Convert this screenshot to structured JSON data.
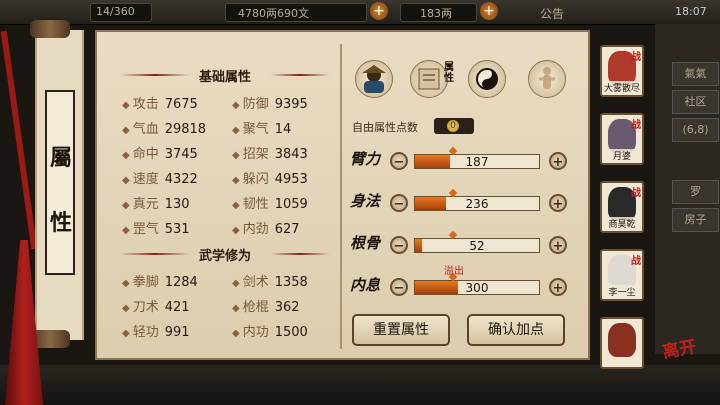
{
  "topbar": {
    "bag_text": "14/360",
    "money_text": "4780两690文",
    "silver_text": "183两",
    "notice_label": "公告",
    "clock": "18:07"
  },
  "side_tabs": [
    "氣氣",
    "社区",
    "(6,8)",
    "罗",
    "房子"
  ],
  "scroll": {
    "char1": "屬",
    "char2": "性"
  },
  "basic": {
    "title": "基础属性",
    "stats": [
      {
        "label": "攻击",
        "value": "7675"
      },
      {
        "label": "防御",
        "value": "9395"
      },
      {
        "label": "气血",
        "value": "29818"
      },
      {
        "label": "聚气",
        "value": "14"
      },
      {
        "label": "命中",
        "value": "3745"
      },
      {
        "label": "招架",
        "value": "3843"
      },
      {
        "label": "速度",
        "value": "4322"
      },
      {
        "label": "躲闪",
        "value": "4953"
      },
      {
        "label": "真元",
        "value": "130"
      },
      {
        "label": "韧性",
        "value": "1059"
      },
      {
        "label": "罡气",
        "value": "531"
      },
      {
        "label": "内劲",
        "value": "627"
      }
    ]
  },
  "martial": {
    "title": "武学修为",
    "stats": [
      {
        "label": "拳脚",
        "value": "1284"
      },
      {
        "label": "剑术",
        "value": "1358"
      },
      {
        "label": "刀术",
        "value": "421"
      },
      {
        "label": "枪棍",
        "value": "362"
      },
      {
        "label": "轻功",
        "value": "991"
      },
      {
        "label": "内功",
        "value": "1500"
      }
    ]
  },
  "tabs": {
    "icons": [
      "character-icon",
      "attribute-scroll-icon",
      "taiji-icon",
      "meridian-figure-icon"
    ],
    "active_tab_label": "属性"
  },
  "free_points": {
    "label": "自由属性点数",
    "value": "0"
  },
  "attributes": [
    {
      "calligraphy": "臂力",
      "value": 187,
      "display": "187",
      "fill_pct": 28
    },
    {
      "calligraphy": "身法",
      "value": 236,
      "display": "236",
      "fill_pct": 25
    },
    {
      "calligraphy": "根骨",
      "value": 52,
      "display": "52",
      "fill_pct": 6
    },
    {
      "calligraphy": "内息",
      "value": 300,
      "display": "300",
      "fill_pct": 35
    }
  ],
  "overflow_label": "溢出",
  "buttons": {
    "reset": "重置属性",
    "confirm": "确认加点"
  },
  "characters": [
    {
      "name": "大雾散尽",
      "battle": "战",
      "color": "#b03a2a"
    },
    {
      "name": "月婆",
      "battle": "战",
      "color": "#6a5a70"
    },
    {
      "name": "商昊乾",
      "battle": "战",
      "color": "#2a2a2a"
    },
    {
      "name": "李一尘",
      "battle": "战",
      "color": "#ddd8d0"
    },
    {
      "name": "",
      "battle": "",
      "color": "#8a3020"
    }
  ],
  "leave_label": "离开",
  "colors": {
    "accent_orange": "#e67a22",
    "battle_red": "#c0201a",
    "paper": "#e9dcc2"
  }
}
